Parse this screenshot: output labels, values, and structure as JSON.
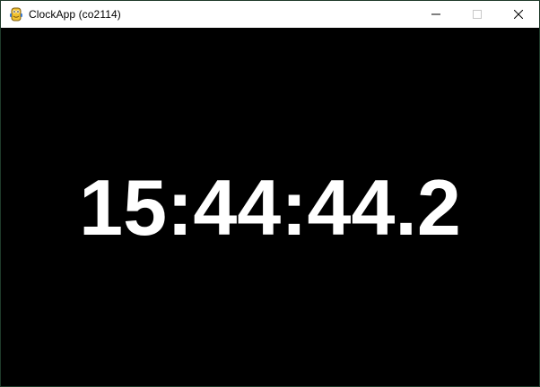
{
  "window": {
    "title": "ClockApp (co2114)",
    "app_icon": "python-snake-icon",
    "controls": {
      "minimize_icon": "minimize-icon",
      "maximize_icon": "maximize-icon",
      "close_icon": "close-icon"
    }
  },
  "clock": {
    "time": "15:44:44.2"
  },
  "colors": {
    "background": "#000000",
    "clock_text": "#ffffff",
    "titlebar": "#ffffff"
  }
}
